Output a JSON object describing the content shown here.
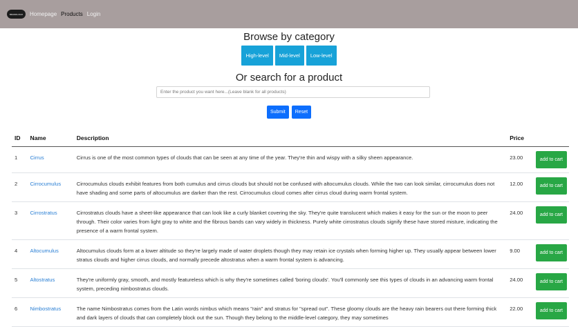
{
  "navbar": {
    "logo_text": "BRANDLOGO",
    "links": [
      "Homepage",
      "Products",
      "Login"
    ],
    "active_link": "Products"
  },
  "browse": {
    "title": "Browse by category",
    "categories": [
      "High-level",
      "Mid-level",
      "Low-level"
    ]
  },
  "search": {
    "title": "Or search for a product",
    "placeholder": "Enter the product you want here...(Leave blank for all products)",
    "submit_label": "Submit",
    "reset_label": "Reset"
  },
  "table": {
    "headers": {
      "id": "ID",
      "name": "Name",
      "description": "Description",
      "price": "Price"
    },
    "add_to_cart_label": "add to cart",
    "rows": [
      {
        "id": "1",
        "name": "Cirrus",
        "description": "Cirrus is one of the most common types of clouds that can be seen at any time of the year. They're thin and wispy with a silky sheen appearance.",
        "price": "23.00"
      },
      {
        "id": "2",
        "name": "Cirrocumulus",
        "description": "Cirrocumulus clouds exhibit features from both cumulus and cirrus clouds but should not be confused with altocumulus clouds. While the two can look similar, cirrocumulus does not have shading and some parts of altocumulus are darker than the rest. Cirrocumulus cloud comes after cirrus cloud during warm frontal system.",
        "price": "12.00"
      },
      {
        "id": "3",
        "name": "Cirrostratus",
        "description": "Cirrostratus clouds have a sheet-like appearance that can look like a curly blanket covering the sky. They're quite translucent which makes it easy for the sun or the moon to peer through. Their color varies from light gray to white and the fibrous bands can vary widely in thickness. Purely white cirrostratus clouds signify these have stored misture, indicating the presence of a warm frontal system.",
        "price": "24.00"
      },
      {
        "id": "4",
        "name": "Altocumulus",
        "description": "Altocumulus clouds form at a lower altitude so they're largely made of water droplets though they may retain ice crystals when forming higher up. They usually appear between lower stratus clouds and higher cirrus clouds, and normally precede altostratus when a warm frontal system is advancing.",
        "price": "9.00"
      },
      {
        "id": "5",
        "name": "Altostratus",
        "description": "They're uniformly gray, smooth, and mostly featureless which is why they're sometimes called 'boring clouds'. You'll commonly see this types of clouds in an advancing warm frontal system, preceding nimbostratus clouds.",
        "price": "24.00"
      },
      {
        "id": "6",
        "name": "Nimbostratus",
        "description": "The name Nimbostratus comes from the Latin words nimbus which means \"rain\" and stratus for \"spread out\". These gloomy clouds are the heavy rain bearers out there forming thick and dark layers of clouds that can completely block out the sun. Though they belong to the middle-level category, they may sometimes",
        "price": "22.00"
      }
    ]
  },
  "colors": {
    "navbar_bg": "#a89e9e",
    "info_button": "#17a2d8",
    "primary_button": "#0d6efd",
    "cart_button": "#28a745",
    "link": "#2a7fd4"
  }
}
